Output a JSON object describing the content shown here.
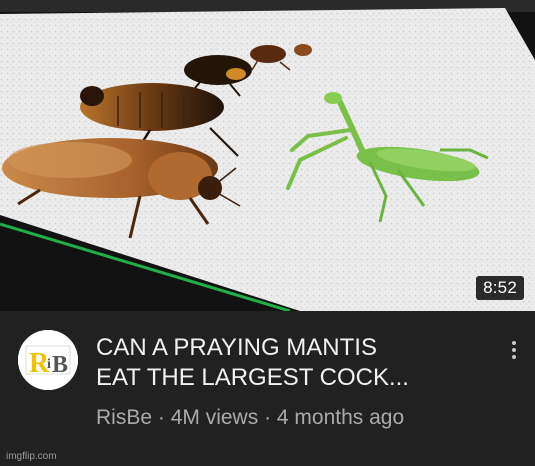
{
  "video": {
    "duration": "8:52",
    "title_line1": "CAN A PRAYING MANTIS",
    "title_line2": "EAT THE LARGEST COCK...",
    "channel": "RisBe",
    "separator": " · ",
    "views": "4M views",
    "age": "4 months ago"
  },
  "avatar": {
    "logo_text": "RiB",
    "logo_color": "#f2c200"
  },
  "watermark": "imgflip.com",
  "icons": {
    "more": "more-vert-icon"
  }
}
